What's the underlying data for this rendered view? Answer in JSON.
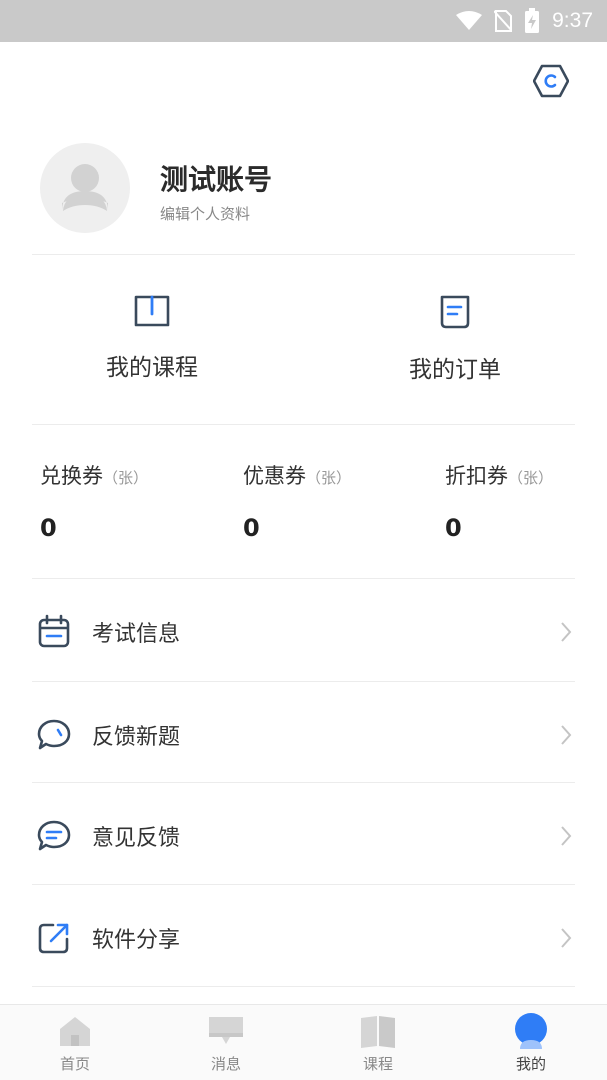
{
  "status_bar": {
    "time": "9:37"
  },
  "profile": {
    "username": "测试账号",
    "edit_label": "编辑个人资料"
  },
  "quick_actions": [
    {
      "label": "我的课程",
      "icon": "book-icon"
    },
    {
      "label": "我的订单",
      "icon": "document-icon"
    }
  ],
  "coupons": [
    {
      "title": "兑换券",
      "unit": "（张）",
      "value": "0"
    },
    {
      "title": "优惠券",
      "unit": "（张）",
      "value": "0"
    },
    {
      "title": "折扣券",
      "unit": "（张）",
      "value": "0"
    }
  ],
  "menu": [
    {
      "label": "考试信息",
      "icon": "calendar-icon"
    },
    {
      "label": "反馈新题",
      "icon": "chat-bubble-icon"
    },
    {
      "label": "意见反馈",
      "icon": "message-icon"
    },
    {
      "label": "软件分享",
      "icon": "share-icon"
    }
  ],
  "bottom_nav": [
    {
      "label": "首页",
      "icon": "home-icon"
    },
    {
      "label": "消息",
      "icon": "message-icon"
    },
    {
      "label": "课程",
      "icon": "book-icon"
    },
    {
      "label": "我的",
      "icon": "profile-icon",
      "active": true
    }
  ],
  "colors": {
    "accent": "#2f7df6",
    "icon_dark": "#3a4a5c",
    "status_bar": "#c9c9c9"
  }
}
